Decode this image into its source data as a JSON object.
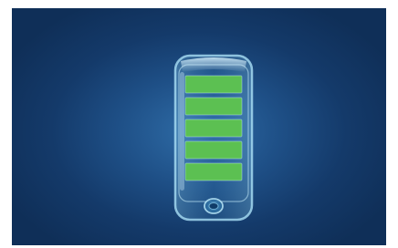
{
  "battery": {
    "bars_filled": 5,
    "bars_total": 5,
    "level": 1.0,
    "bar_color": "#5cc052",
    "icon": "battery-full-icon"
  },
  "colors": {
    "background_center": "#2f6da8",
    "background_edge": "#0f2f58",
    "glass_outline": "#9fd8f0"
  }
}
